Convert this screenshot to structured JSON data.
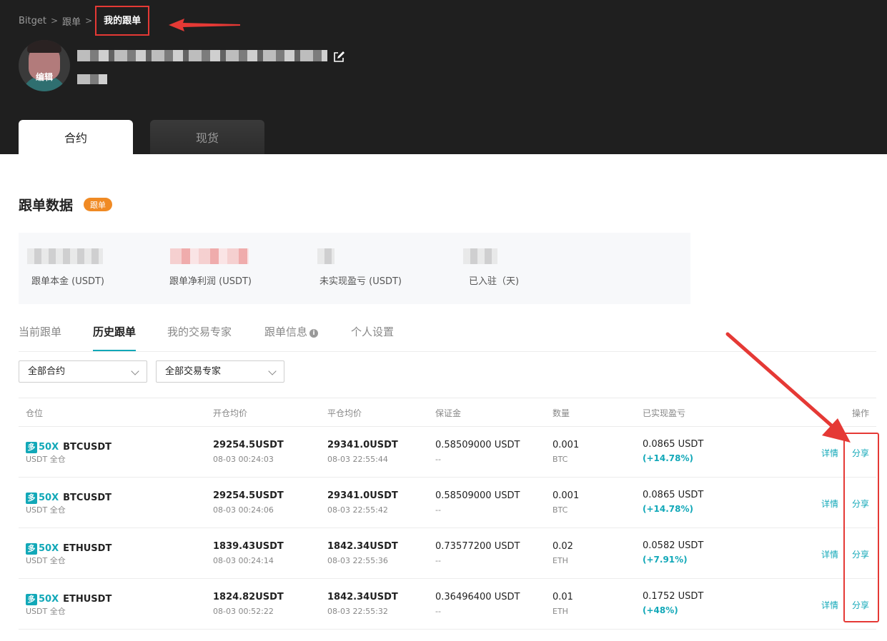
{
  "breadcrumb": {
    "home": "Bitget",
    "parent": "跟单",
    "current": "我的跟单"
  },
  "profile": {
    "edit_label": "编辑"
  },
  "market_tabs": [
    {
      "label": "合约"
    },
    {
      "label": "现货"
    }
  ],
  "section": {
    "title": "跟单数据",
    "badge": "跟单"
  },
  "stats": [
    {
      "label": "跟单本金 (USDT)"
    },
    {
      "label": "跟单净利润 (USDT)"
    },
    {
      "label": "未实现盈亏 (USDT)"
    },
    {
      "label": "已入驻（天)"
    }
  ],
  "subtabs": [
    {
      "label": "当前跟单"
    },
    {
      "label": "历史跟单"
    },
    {
      "label": "我的交易专家"
    },
    {
      "label": "跟单信息"
    },
    {
      "label": "个人设置"
    }
  ],
  "filters": {
    "contract": "全部合约",
    "expert": "全部交易专家"
  },
  "table": {
    "headers": [
      "仓位",
      "开仓均价",
      "平仓均价",
      "保证金",
      "数量",
      "已实现盈亏",
      "操作"
    ],
    "rows": [
      {
        "side": "多",
        "leverage": "50X",
        "symbol": "BTCUSDT",
        "margin_mode": "USDT 全仓",
        "open_price": "29254.5USDT",
        "open_time": "08-03 00:24:03",
        "close_price": "29341.0USDT",
        "close_time": "08-03 22:55:44",
        "margin": "0.58509000 USDT",
        "margin_sub": "--",
        "qty": "0.001",
        "qty_unit": "BTC",
        "pnl": "0.0865 USDT",
        "pnl_pct": "(+14.78%)",
        "detail": "详情",
        "share": "分享"
      },
      {
        "side": "多",
        "leverage": "50X",
        "symbol": "BTCUSDT",
        "margin_mode": "USDT 全仓",
        "open_price": "29254.5USDT",
        "open_time": "08-03 00:24:06",
        "close_price": "29341.0USDT",
        "close_time": "08-03 22:55:42",
        "margin": "0.58509000 USDT",
        "margin_sub": "--",
        "qty": "0.001",
        "qty_unit": "BTC",
        "pnl": "0.0865 USDT",
        "pnl_pct": "(+14.78%)",
        "detail": "详情",
        "share": "分享"
      },
      {
        "side": "多",
        "leverage": "50X",
        "symbol": "ETHUSDT",
        "margin_mode": "USDT 全仓",
        "open_price": "1839.43USDT",
        "open_time": "08-03 00:24:14",
        "close_price": "1842.34USDT",
        "close_time": "08-03 22:55:36",
        "margin": "0.73577200 USDT",
        "margin_sub": "--",
        "qty": "0.02",
        "qty_unit": "ETH",
        "pnl": "0.0582 USDT",
        "pnl_pct": "(+7.91%)",
        "detail": "详情",
        "share": "分享"
      },
      {
        "side": "多",
        "leverage": "50X",
        "symbol": "ETHUSDT",
        "margin_mode": "USDT 全仓",
        "open_price": "1824.82USDT",
        "open_time": "08-03 00:52:22",
        "close_price": "1842.34USDT",
        "close_time": "08-03 22:55:32",
        "margin": "0.36496400 USDT",
        "margin_sub": "--",
        "qty": "0.01",
        "qty_unit": "ETH",
        "pnl": "0.1752 USDT",
        "pnl_pct": "(+48%)",
        "detail": "详情",
        "share": "分享"
      }
    ]
  },
  "colors": {
    "accent": "#12a8b8",
    "annotation_red": "#e53935",
    "badge_orange": "#f08a24",
    "header_bg": "#1f1f1f"
  }
}
